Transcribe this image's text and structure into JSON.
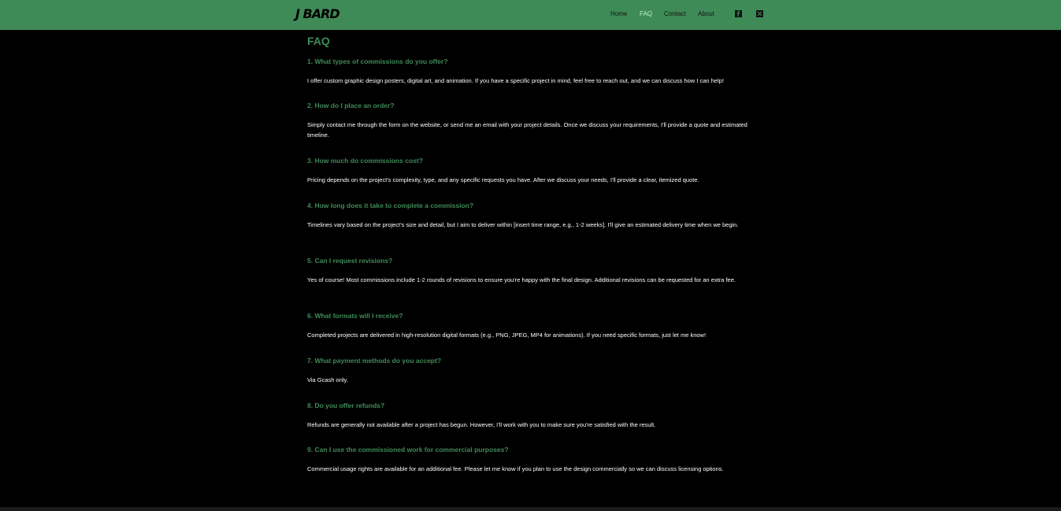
{
  "header": {
    "logo": "J BARD",
    "nav": {
      "home": "Home",
      "faq": "FAQ",
      "contact": "Contact",
      "about": "About"
    },
    "social_icons": [
      "facebook-icon",
      "x-icon"
    ]
  },
  "colors": {
    "accent": "#3f8b57",
    "background": "#000000",
    "active_nav": "#b7f5c8"
  },
  "page": {
    "title": "FAQ",
    "faqs": [
      {
        "question": "1. What types of commissions do you offer?",
        "answer": "I offer custom graphic design posters, digital art, and animation. If you have a specific project in mind, feel free to reach out, and we can discuss how I can help!"
      },
      {
        "question": "2. How do I place an order?",
        "answer": "Simply contact me through the form on the website, or send me an email with your project details. Once we discuss your requirements, I'll provide a quote and estimated timeline."
      },
      {
        "question": "3. How much do commissions cost?",
        "answer": "Pricing depends on the project's complexity, type, and any specific requests you have. After we discuss your needs, I'll provide a clear, itemized quote."
      },
      {
        "question": "4. How long does it take to complete a commission?",
        "answer": "Timelines vary based on the project's size and detail, but I aim to deliver within [insert time range, e.g., 1-2 weeks]. I'll give an estimated delivery time when we begin."
      },
      {
        "question": "5. Can I request revisions?",
        "answer": "Yes of course! Most commissions include 1-2 rounds of revisions to ensure you're happy with the final design. Additional revisions can be requested for an extra fee."
      },
      {
        "question": "6. What formats will I receive?",
        "answer": "Completed projects are delivered in high-resolution digital formats (e.g., PNG, JPEG, MP4 for animations). If you need specific formats, just let me know!"
      },
      {
        "question": "7. What payment methods do you accept?",
        "answer": "Via Gcash only."
      },
      {
        "question": "8. Do you offer refunds?",
        "answer": "Refunds are generally not available after a project has begun. However, I'll work with you to make sure you're satisfied with the result."
      },
      {
        "question": "9. Can I use the commissioned work for commercial purposes?",
        "answer": "Commercial usage rights are available for an additional fee. Please let me know if you plan to use the design commercially so we can discuss licensing options."
      }
    ]
  }
}
